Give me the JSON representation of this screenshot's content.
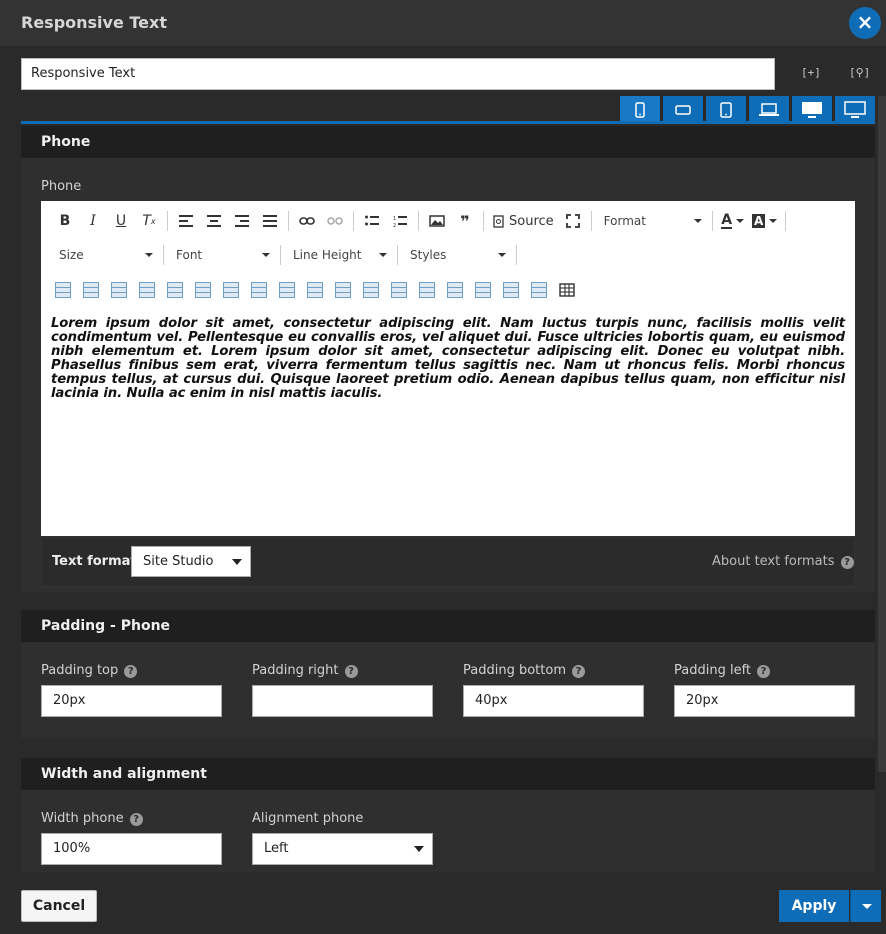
{
  "dialog": {
    "title": "Responsive Text",
    "close_icon": "×"
  },
  "name_field": {
    "value": "Responsive Text"
  },
  "header_icons": {
    "expand": "[+]",
    "search": "[⚲]"
  },
  "device_tabs": [
    {
      "name": "phone"
    },
    {
      "name": "phone-landscape"
    },
    {
      "name": "tablet"
    },
    {
      "name": "laptop"
    },
    {
      "name": "desktop"
    },
    {
      "name": "desktop-large"
    }
  ],
  "phone_section": {
    "header": "Phone",
    "label": "Phone",
    "toolbar": {
      "source_label": "Source",
      "format_label": "Format",
      "size_label": "Size",
      "font_label": "Font",
      "line_height_label": "Line Height",
      "styles_label": "Styles"
    },
    "content": "Lorem ipsum dolor sit amet, consectetur adipiscing elit. Nam luctus turpis nunc, facilisis mollis velit condimentum vel. Pellentesque eu convallis eros, vel aliquet dui. Fusce ultricies lobortis quam, eu euismod nibh elementum et. Lorem ipsum dolor sit amet, consectetur adipiscing elit. Donec eu volutpat nibh. Phasellus finibus sem erat, viverra fermentum tellus sagittis nec. Nam ut rhoncus felis. Morbi rhoncus tempus tellus, at cursus dui. Quisque laoreet pretium odio. Aenean dapibus tellus quam, non efficitur nisl lacinia in. Nulla ac enim in nisl mattis iaculis.",
    "text_format_label": "Text format",
    "text_format_value": "Site Studio",
    "about_text_formats": "About text formats"
  },
  "padding_section": {
    "header": "Padding - Phone",
    "top_label": "Padding top",
    "top_value": "20px",
    "right_label": "Padding right",
    "right_value": "",
    "bottom_label": "Padding bottom",
    "bottom_value": "40px",
    "left_label": "Padding left",
    "left_value": "20px"
  },
  "width_section": {
    "header": "Width and alignment",
    "width_label": "Width phone",
    "width_value": "100%",
    "alignment_label": "Alignment phone",
    "alignment_value": "Left"
  },
  "footer": {
    "cancel": "Cancel",
    "apply": "Apply"
  },
  "colors": {
    "accent": "#0f6db7",
    "background": "#2a2a2a",
    "section_header": "#1f1f1f"
  }
}
